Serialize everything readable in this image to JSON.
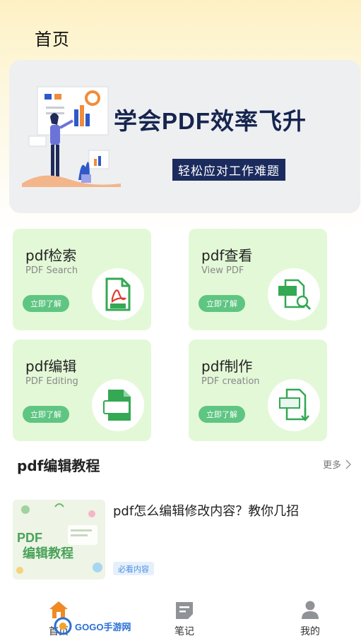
{
  "header": {
    "title": "首页"
  },
  "banner": {
    "headline": "学会PDF效率飞升",
    "subtitle": "轻松应对工作难题"
  },
  "cards": [
    {
      "title": "pdf检索",
      "subtitle": "PDF Search",
      "button": "立即了解",
      "icon": "pdf-file-icon"
    },
    {
      "title": "pdf查看",
      "subtitle": "View PDF",
      "button": "立即了解",
      "icon": "pdf-view-icon"
    },
    {
      "title": "pdf编辑",
      "subtitle": "PDF Editing",
      "button": "立即了解",
      "icon": "pdf-edit-icon"
    },
    {
      "title": "pdf制作",
      "subtitle": "PDF creation",
      "button": "立即了解",
      "icon": "pdf-create-icon"
    }
  ],
  "section": {
    "title": "pdf编辑教程",
    "more": "更多"
  },
  "article": {
    "title": "pdf怎么编辑修改内容？教你几招",
    "tag": "必看内容",
    "thumb_text_line1": "PDF",
    "thumb_text_line2": "编辑教程"
  },
  "tabbar": [
    {
      "label": "首页",
      "icon": "home-icon",
      "active": true
    },
    {
      "label": "笔记",
      "icon": "note-icon",
      "active": false
    },
    {
      "label": "我的",
      "icon": "user-icon",
      "active": false
    }
  ],
  "watermark": {
    "text": "GOGO手游网"
  },
  "colors": {
    "accent_green": "#5fc582",
    "card_bg": "#e3f8d7",
    "nav_active": "#f08a24",
    "banner_navy": "#1c2b5e"
  }
}
